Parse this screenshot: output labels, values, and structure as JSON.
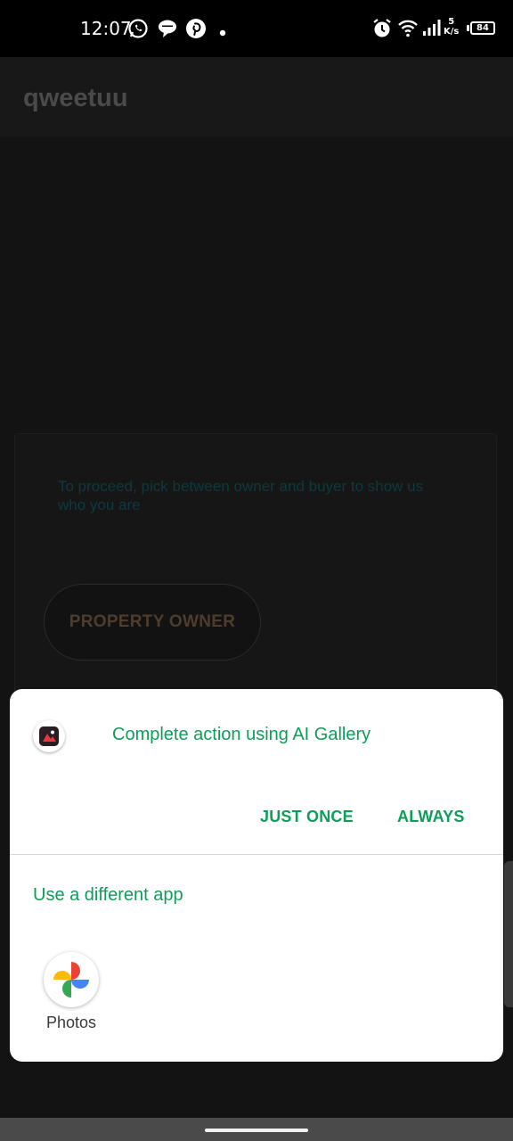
{
  "status_bar": {
    "time": "12:07",
    "notification_icons": [
      "whatsapp-icon",
      "chat-bubble-icon",
      "pinterest-icon",
      "dot-icon"
    ],
    "system_icons": [
      "alarm-icon",
      "wifi-icon",
      "signal-icon"
    ],
    "net_speed_value": "5",
    "net_speed_unit": "K/s",
    "battery": "84"
  },
  "app": {
    "title": "qweetuu"
  },
  "background_card": {
    "prompt": "To proceed, pick between owner and buyer to show us who you are",
    "owner_button": "PROPERTY OWNER"
  },
  "dialog": {
    "title": "Complete action using AI Gallery",
    "just_once": "JUST ONCE",
    "always": "ALWAYS",
    "different_app": "Use a different app",
    "apps": [
      {
        "label": "Photos",
        "icon": "google-photos-icon"
      }
    ]
  },
  "colors": {
    "accent_green": "#0f9d58",
    "background": "#131313",
    "sheet": "#ffffff"
  }
}
